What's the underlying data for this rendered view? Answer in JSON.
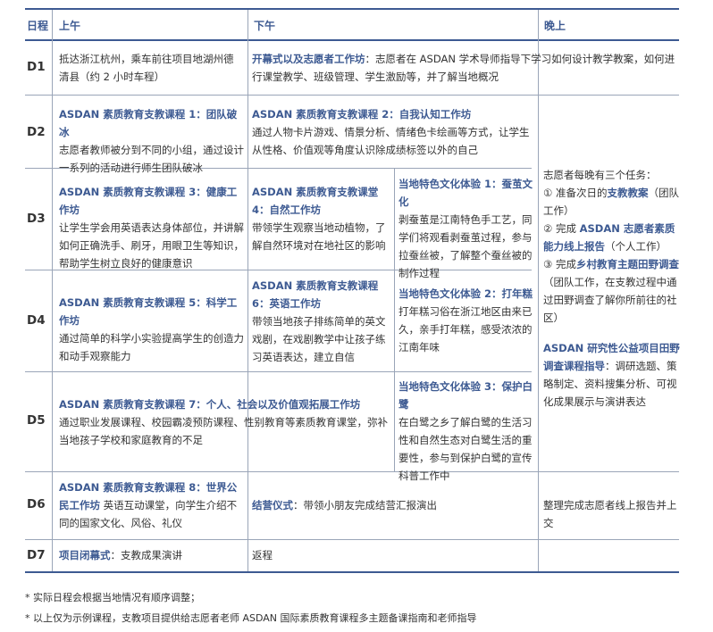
{
  "header": {
    "day": "日程",
    "morning": "上午",
    "afternoon": "下午",
    "evening": "晚上"
  },
  "d1": {
    "label": "D1",
    "morning": "抵达浙江杭州，乘车前往项目地湖州德清县（约 2 小时车程）",
    "afternoon_title": "开幕式以及志愿者工作坊",
    "afternoon_text": "：志愿者在 ASDAN 学术导师指导下学习如何设计教学教案，如何进行课堂教学、班级管理、学生激励等，并了解当地概况"
  },
  "d2": {
    "label": "D2",
    "morning_title": "ASDAN 素质教育支教课程 1：团队破冰",
    "morning_text": "志愿者教师被分到不同的小组，通过设计一系列的活动进行师生团队破冰",
    "afternoon_title": "ASDAN 素质教育支教课程 2：自我认知工作坊",
    "afternoon_text": "通过人物卡片游戏、情景分析、情绪色卡绘画等方式，让学生从性格、价值观等角度认识除成绩标签以外的自己"
  },
  "d3": {
    "label": "D3",
    "morning_title": "ASDAN 素质教育支教课程 3：健康工作坊",
    "morning_text": "让学生学会用英语表达身体部位，并讲解如何正确洗手、刷牙，用眼卫生等知识，帮助学生树立良好的健康意识",
    "afternoon_title": "ASDAN 素质教育支教课堂 4：自然工作坊",
    "afternoon_text": "带领学生观察当地动植物，了解自然环境对在地社区的影响",
    "culture_title": "当地特色文化体验 1：蚕茧文化",
    "culture_text": "剥蚕茧是江南特色手工艺，同学们将观看剥蚕茧过程，参与拉蚕丝被，了解整个蚕丝被的制作过程"
  },
  "d4": {
    "label": "D4",
    "morning_title": "ASDAN 素质教育支教课程 5：科学工作坊",
    "morning_text": "通过简单的科学小实验提高学生的创造力和动手观察能力",
    "afternoon_title": "ASDAN 素质教育支教课程 6：英语工作坊",
    "afternoon_text": "带领当地孩子排练简单的英文戏剧，在戏剧教学中让孩子练习英语表达，建立自信",
    "culture_title": "当地特色文化体验 2：打年糕",
    "culture_text": "打年糕习俗在浙江地区由来已久，亲手打年糕，感受浓浓的江南年味"
  },
  "d5": {
    "label": "D5",
    "morning_title": "ASDAN 素质教育支教课程 7：个人、社会以及价值观拓展工作坊",
    "morning_text": "通过职业发展课程、校园霸凌预防课程、性别教育等素质教育课堂，弥补当地孩子学校和家庭教育的不足",
    "culture_title": "当地特色文化体验 3：保护白鹭",
    "culture_text": "在白鹭之乡了解白鹭的生活习性和自然生态对白鹭生活的重要性，参与到保护白鹭的宣传科普工作中"
  },
  "d6": {
    "label": "D6",
    "morning_title": "ASDAN 素质教育支教课程 8：世界公民工作坊",
    "morning_text": "英语互动课堂，向学生介绍不同的国家文化、风俗、礼仪",
    "afternoon_title": "结营仪式",
    "afternoon_text": "：带领小朋友完成结营汇报演出",
    "evening": "整理完成志愿者线上报告并上交"
  },
  "d7": {
    "label": "D7",
    "morning_title": "项目闭幕式",
    "morning_text": "：支教成果演讲",
    "afternoon": "返程"
  },
  "evening_block": {
    "intro": "志愿者每晚有三个任务：",
    "task1_pre": "① 准备次日的",
    "task1_b": "支教教案",
    "task1_post": "（团队工作）",
    "task2_pre": "② 完成",
    "task2_b": "ASDAN 志愿者素质能力线上报告",
    "task2_post": "（个人工作）",
    "task3_pre": "③ 完成",
    "task3_b": "乡村教育主题田野调查",
    "task3_post": "（团队工作，在支教过程中通过田野调查了解你所前往的社区）",
    "research_title": "ASDAN 研究性公益项目田野调查课程指导",
    "research_text": "：调研选题、策略制定、资料搜集分析、可视化成果展示与演讲表达"
  },
  "notes": [
    "* 实际日程会根据当地情况有顺序调整；",
    "* 以上仅为示例课程，支教项目提供给志愿者老师 ASDAN 国际素质教育课程多主题备课指南和老师指导"
  ]
}
